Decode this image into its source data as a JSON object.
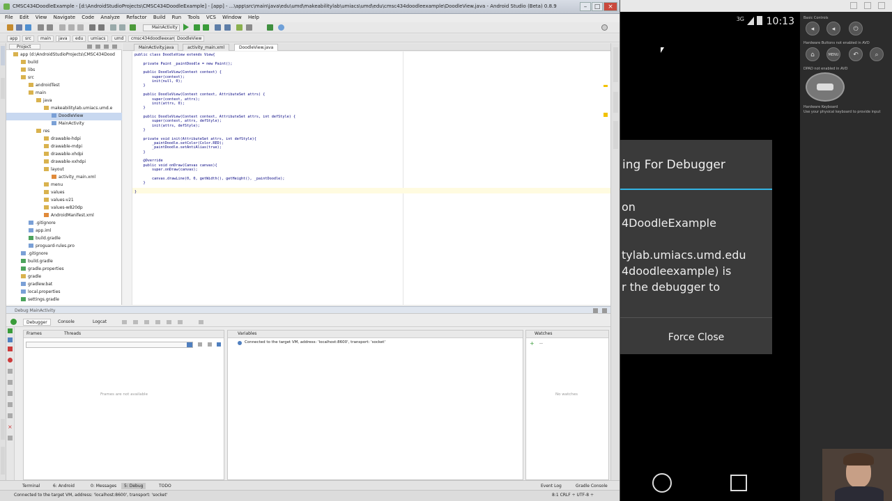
{
  "ide": {
    "title": "CMSC434DoodleExample - [d:\\AndroidStudioProjects\\CMSC434DoodleExample] - [app] - ...\\app\\src\\main\\java\\edu\\umd\\makeabilitylab\\umiacs\\umd\\edu\\cmsc434doodleexample\\DoodleView.java - Android Studio (Beta) 0.8.9",
    "menu": [
      "File",
      "Edit",
      "View",
      "Navigate",
      "Code",
      "Analyze",
      "Refactor",
      "Build",
      "Run",
      "Tools",
      "VCS",
      "Window",
      "Help"
    ],
    "run_config": "MainActivity",
    "nav_path": [
      "app",
      "src",
      "main",
      "java",
      "edu",
      "umiacs",
      "umd",
      "cmsc434doodleexample",
      "DoodleView"
    ],
    "project_header": "Project",
    "tree": [
      {
        "label": "app (d:\\AndroidStudioProjects\\CMSC434Dood",
        "indent": 0,
        "type": "fold"
      },
      {
        "label": "build",
        "indent": 1,
        "type": "fold"
      },
      {
        "label": "libs",
        "indent": 1,
        "type": "fold"
      },
      {
        "label": "src",
        "indent": 1,
        "type": "fold"
      },
      {
        "label": "androidTest",
        "indent": 2,
        "type": "fold"
      },
      {
        "label": "main",
        "indent": 2,
        "type": "fold"
      },
      {
        "label": "java",
        "indent": 3,
        "type": "fold"
      },
      {
        "label": "makeabilitylab.umiacs.umd.e",
        "indent": 4,
        "type": "fold"
      },
      {
        "label": "DoodleView",
        "indent": 5,
        "type": "file",
        "selected": true
      },
      {
        "label": "MainActivity",
        "indent": 5,
        "type": "file"
      },
      {
        "label": "res",
        "indent": 3,
        "type": "fold"
      },
      {
        "label": "drawable-hdpi",
        "indent": 4,
        "type": "fold"
      },
      {
        "label": "drawable-mdpi",
        "indent": 4,
        "type": "fold"
      },
      {
        "label": "drawable-xhdpi",
        "indent": 4,
        "type": "fold"
      },
      {
        "label": "drawable-xxhdpi",
        "indent": 4,
        "type": "fold"
      },
      {
        "label": "layout",
        "indent": 4,
        "type": "fold"
      },
      {
        "label": "activity_main.xml",
        "indent": 5,
        "type": "xml"
      },
      {
        "label": "menu",
        "indent": 4,
        "type": "fold"
      },
      {
        "label": "values",
        "indent": 4,
        "type": "fold"
      },
      {
        "label": "values-v21",
        "indent": 4,
        "type": "fold"
      },
      {
        "label": "values-w820dp",
        "indent": 4,
        "type": "fold"
      },
      {
        "label": "AndroidManifest.xml",
        "indent": 4,
        "type": "xml"
      },
      {
        "label": ".gitignore",
        "indent": 2,
        "type": "file"
      },
      {
        "label": "app.iml",
        "indent": 2,
        "type": "file"
      },
      {
        "label": "build.gradle",
        "indent": 2,
        "type": "gr"
      },
      {
        "label": "proguard-rules.pro",
        "indent": 2,
        "type": "file"
      },
      {
        "label": ".gitignore",
        "indent": 1,
        "type": "file"
      },
      {
        "label": "build.gradle",
        "indent": 1,
        "type": "gr"
      },
      {
        "label": "gradle.properties",
        "indent": 1,
        "type": "gr"
      },
      {
        "label": "gradle",
        "indent": 1,
        "type": "fold"
      },
      {
        "label": "gradlew.bat",
        "indent": 1,
        "type": "file"
      },
      {
        "label": "local.properties",
        "indent": 1,
        "type": "file"
      },
      {
        "label": "settings.gradle",
        "indent": 1,
        "type": "gr"
      }
    ],
    "editor_tabs": [
      "MainActivity.java",
      "activity_main.xml",
      "DoodleView.java"
    ],
    "code": [
      "public class DoodleView extends View{",
      "",
      "    private Paint _paintDoodle = new Paint();",
      "",
      "    public DoodleView(Context context) {",
      "        super(context);",
      "        init(null, 0);",
      "    }",
      "",
      "    public DoodleView(Context context, AttributeSet attrs) {",
      "        super(context, attrs);",
      "        init(attrs, 0);",
      "    }",
      "",
      "    public DoodleView(Context context, AttributeSet attrs, int defStyle) {",
      "        super(context, attrs, defStyle);",
      "        init(attrs, defStyle);",
      "    }",
      "",
      "    private void init(AttributeSet attrs, int defStyle){",
      "        _paintDoodle.setColor(Color.RED);",
      "        _paintDoodle.setAntiAlias(true);",
      "    }",
      "",
      "    @Override",
      "    public void onDraw(Canvas canvas){",
      "        super.onDraw(canvas);",
      "",
      "        canvas.drawLine(0, 0, getWidth(), getHeight(), _paintDoodle);",
      "    }",
      "",
      "}"
    ],
    "debug_bar": "Debug    MainActivity",
    "debug_tabs": [
      "Debugger",
      "Console",
      "Logcat"
    ],
    "frames_tabs": [
      "Frames",
      "Threads"
    ],
    "frames_empty": "Frames are not available",
    "variables_header": "Variables",
    "variables_msg": "Connected to the target VM, address: 'localhost:8600', transport: 'socket'",
    "watches_header": "Watches",
    "watches_empty": "No watches",
    "bottom_tabs": [
      "Terminal",
      "6: Android",
      "0: Messages",
      "5: Debug",
      "TODO"
    ],
    "bottom_right": [
      "Event Log",
      "Gradle Console"
    ],
    "status": "Connected to the target VM, address: 'localhost:8600', transport: 'socket'",
    "status_right": "8:1   CRLF ÷   UTF-8 ÷"
  },
  "phone": {
    "clock": "10:13",
    "network": "3G",
    "dialog_title": "ing For Debugger",
    "dialog_body": "on\n4DoodleExample\n\ntylab.umiacs.umd.edu\n4doodleexample) is\nr the debugger to",
    "force_close": "Force Close"
  },
  "emulator": {
    "basic_controls": "Basic Controls",
    "hardware_buttons": "Hardware Buttons not enabled in AVD",
    "dpad": "DPAD not enabled in AVD",
    "keyboard": "Hardware Keyboard",
    "keyboard_hint": "Use your physical keyboard to provide input",
    "menu": "MENU"
  }
}
